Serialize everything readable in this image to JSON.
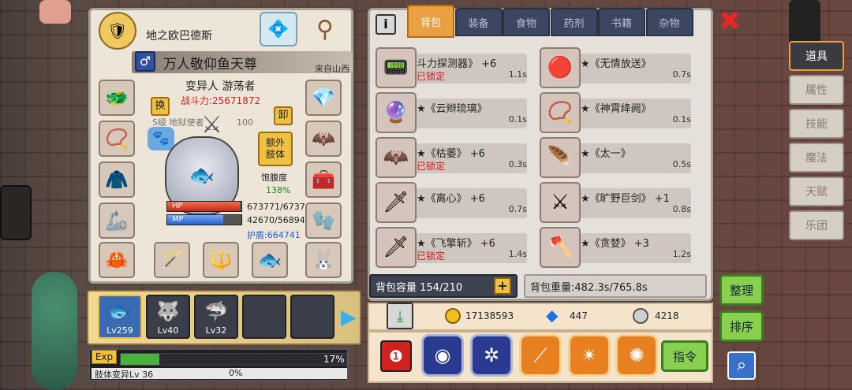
{
  "character": {
    "name": "地之欧巴德斯",
    "title": "万人敬仰鱼天尊",
    "origin": "来自山西",
    "class": "变异人 游荡者",
    "power_label": "战斗力:25671872",
    "swap_label": "换",
    "unequip_label": "卸",
    "extra_limb_label": "额外\n肢体",
    "satiety_label": "饱腹度",
    "satiety_value": "138%",
    "pet_tag": "S级 地狱使者",
    "pet_level": "100",
    "hp_label": "HP",
    "hp_value": "673771/6737",
    "mp_label": "MP",
    "mp_value": "42670/56894",
    "shield_value": "护盾:664741",
    "hp_fill": 0.98,
    "mp_fill": 0.75
  },
  "companions": [
    {
      "level": "Lv259",
      "icon": "🐟"
    },
    {
      "level": "Lv40",
      "icon": "🐺"
    },
    {
      "level": "Lv32",
      "icon": "🦈"
    },
    {
      "level": "",
      "icon": ""
    },
    {
      "level": "",
      "icon": ""
    }
  ],
  "exp": {
    "label": "Exp",
    "percent": "17%",
    "fill": 0.17,
    "limb": "肢体变异Lv 36",
    "sub": "0%"
  },
  "tabs": [
    "背包",
    "装备",
    "食物",
    "药剂",
    "书籍",
    "杂物"
  ],
  "info_icon": "i",
  "items": [
    {
      "name": "斗力探测器》 +6",
      "time": "1.1s",
      "locked": "已锁定",
      "icon": "📟"
    },
    {
      "name": "★《无情放送》",
      "time": "0.7s",
      "locked": "",
      "icon": "🔴"
    },
    {
      "name": "★《云辫琉璃》",
      "time": "0.1s",
      "locked": "",
      "icon": "🔮"
    },
    {
      "name": "★《神霄绛阙》",
      "time": "0.1s",
      "locked": "",
      "icon": "📿"
    },
    {
      "name": "★《枯萎》 +6",
      "time": "0.3s",
      "locked": "已锁定",
      "icon": "🦇"
    },
    {
      "name": "★《太一》",
      "time": "0.5s",
      "locked": "",
      "icon": "🪶"
    },
    {
      "name": "★《离心》 +6",
      "time": "0.7s",
      "locked": "",
      "icon": "🗡"
    },
    {
      "name": "★《旷野巨剑》 +1",
      "time": "0.8s",
      "locked": "",
      "icon": "⚔"
    },
    {
      "name": "★《飞擎斩》 +6",
      "time": "1.4s",
      "locked": "已锁定",
      "icon": "🗡"
    },
    {
      "name": "★《贪婪》 +3",
      "time": "1.2s",
      "locked": "",
      "icon": "🪓"
    }
  ],
  "capacity": "背包容量 154/210",
  "weight": "背包重量:482.3s/765.8s",
  "currency": {
    "gold": "17138593",
    "diamond": "447",
    "silver": "4218"
  },
  "side_tabs": [
    "道具",
    "属性",
    "技能",
    "魔法",
    "天赋",
    "乐团"
  ],
  "buttons": {
    "sort": "整理",
    "order": "排序",
    "command": "指令",
    "plus": "+"
  }
}
